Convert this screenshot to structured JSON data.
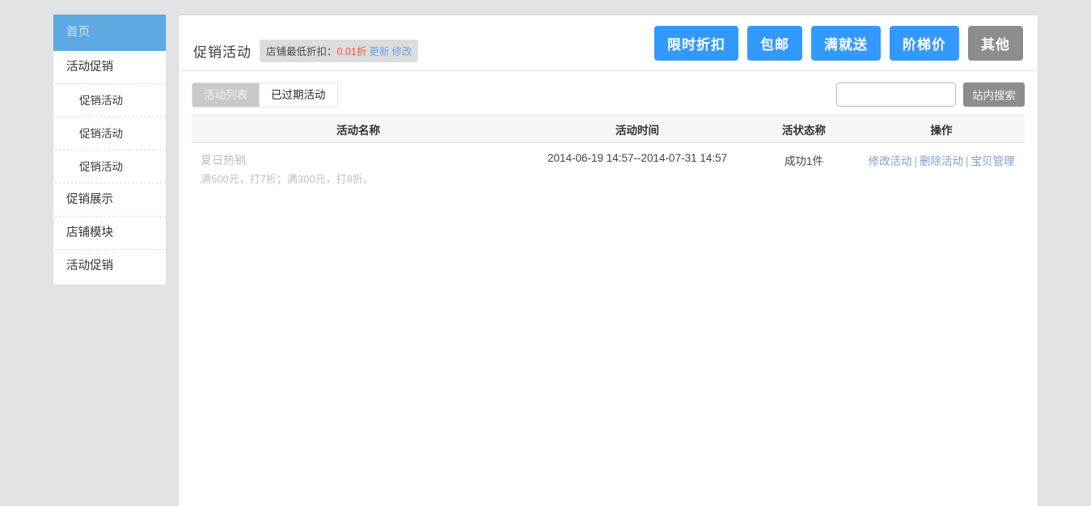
{
  "sidebar": {
    "items": [
      {
        "label": "首页",
        "active": true,
        "sub": false
      },
      {
        "label": "活动促销",
        "active": false,
        "sub": false
      },
      {
        "label": "促销活动",
        "active": false,
        "sub": true
      },
      {
        "label": "促销活动",
        "active": false,
        "sub": true
      },
      {
        "label": "促销活动",
        "active": false,
        "sub": true
      },
      {
        "label": "促销展示",
        "active": false,
        "sub": false
      },
      {
        "label": "店铺模块",
        "active": false,
        "sub": false
      },
      {
        "label": "活动促销",
        "active": false,
        "sub": false
      }
    ]
  },
  "header": {
    "title": "促销活动",
    "badge": {
      "label": "店铺最低折扣：",
      "amount": "0.01折",
      "update_label": "更新",
      "edit_label": "修改",
      "amount_color": "#f2563f",
      "action_color": "#6aa6e0",
      "bg_color": "#dcdcdc"
    },
    "buttons": [
      {
        "label": "限时折扣",
        "style": "blue"
      },
      {
        "label": "包邮",
        "style": "blue"
      },
      {
        "label": "满就送",
        "style": "blue"
      },
      {
        "label": "阶梯价",
        "style": "blue"
      },
      {
        "label": "其他",
        "style": "grey"
      }
    ],
    "blue_color": "#3399ff",
    "grey_color": "#8d8d8d"
  },
  "toolbar": {
    "tabs": [
      {
        "label": "活动列表",
        "active": true
      },
      {
        "label": "已过期活动",
        "active": false
      }
    ],
    "search": {
      "value": "",
      "placeholder": "",
      "button_label": "站内搜索"
    }
  },
  "table": {
    "columns": [
      "活动名称",
      "活动时间",
      "活状态称",
      "操作"
    ],
    "rows": [
      {
        "name": "夏日热销",
        "description": "满500元，打7折；满300元，打8折。",
        "time": "2014-06-19 14:57--2014-07-31 14:57",
        "status": "成功1件",
        "operations": [
          "修改活动",
          "删除活动",
          "宝贝管理"
        ],
        "separator": "|"
      }
    ]
  }
}
